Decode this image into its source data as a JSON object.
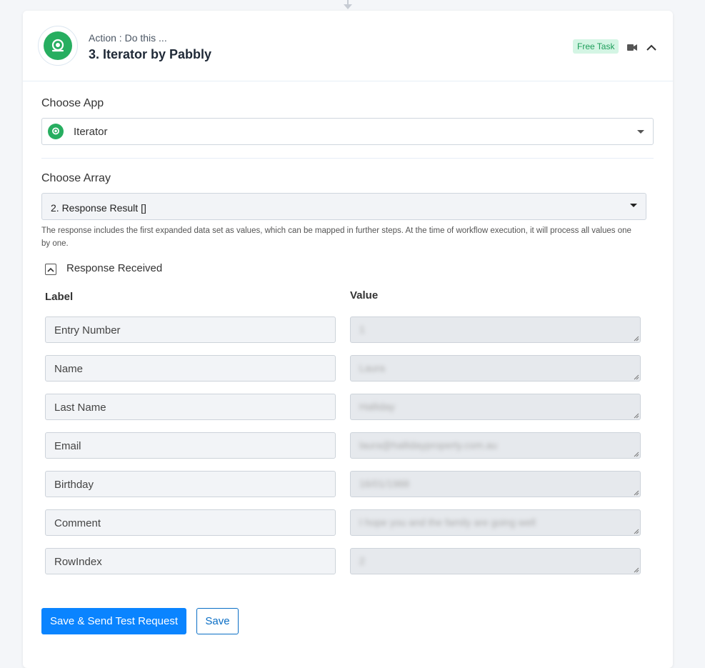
{
  "step": {
    "kicker": "Action : Do this ...",
    "title": "3. Iterator by Pabbly",
    "badge": "Free Task",
    "icons": {
      "app": "iterator-logo-icon",
      "video": "video-camera-icon",
      "collapse": "chevron-up-icon"
    }
  },
  "choose_app": {
    "label": "Choose App",
    "value": "Iterator"
  },
  "choose_array": {
    "label": "Choose Array",
    "value": "2. Response Result []",
    "help": "The response includes the first expanded data set as values, which can be mapped in further steps. At the time of workflow execution, it will process all values one by one."
  },
  "response": {
    "toggle_label": "Response Received",
    "col_label": "Label",
    "col_value": "Value",
    "rows": [
      {
        "label": "Entry Number",
        "value": "1"
      },
      {
        "label": "Name",
        "value": "Laura"
      },
      {
        "label": "Last Name",
        "value": "Halliday"
      },
      {
        "label": "Email",
        "value": "laura@hallidayproperty.com.au"
      },
      {
        "label": "Birthday",
        "value": "16/01/1988"
      },
      {
        "label": "Comment",
        "value": "I hope you and the family are going well"
      },
      {
        "label": "RowIndex",
        "value": "2"
      }
    ]
  },
  "buttons": {
    "save_send": "Save & Send Test Request",
    "save": "Save"
  },
  "colors": {
    "primary": "#0a84ff",
    "iterator_green": "#27ae60",
    "badge_bg": "#d4f5e4",
    "badge_text": "#1e9e5a"
  }
}
